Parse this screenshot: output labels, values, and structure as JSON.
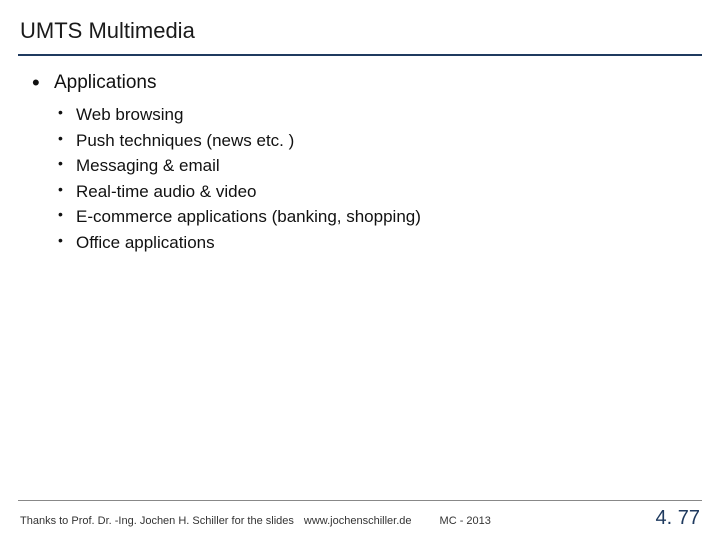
{
  "title": "UMTS Multimedia",
  "content": {
    "heading": "Applications",
    "items": [
      "Web browsing",
      "Push techniques (news etc. )",
      "Messaging & email",
      "Real-time audio & video",
      "E-commerce applications (banking, shopping)",
      "Office applications"
    ]
  },
  "footer": {
    "credit": "Thanks to Prof. Dr. -Ing. Jochen H. Schiller for the slides",
    "url": "www.jochenschiller.de",
    "course": "MC - 2013",
    "page": "4. 77"
  }
}
